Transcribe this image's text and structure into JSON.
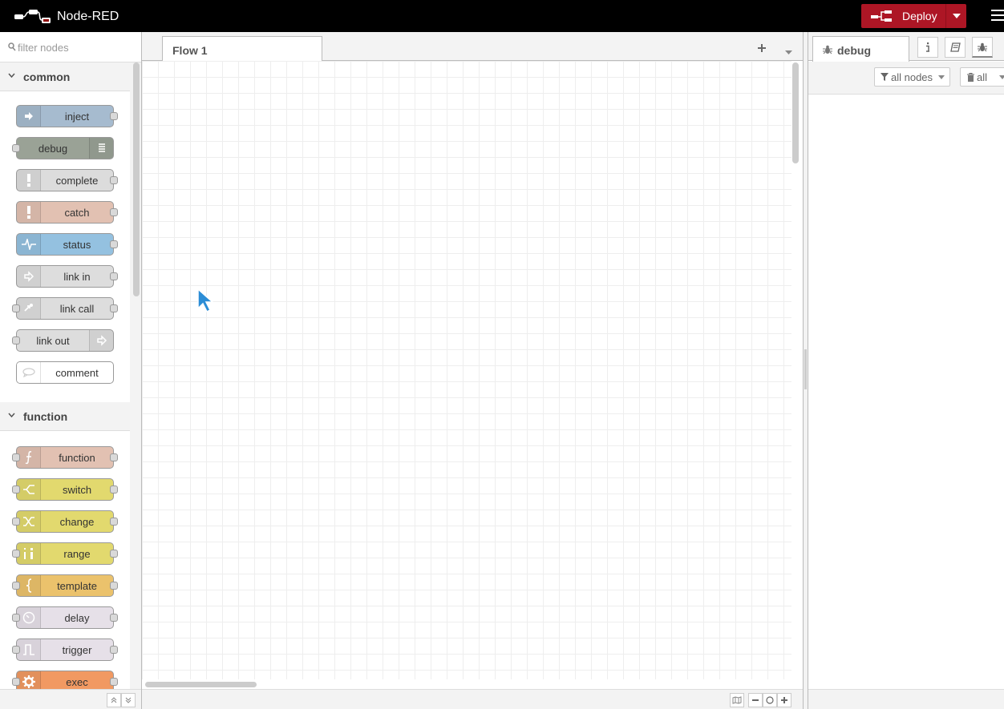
{
  "header": {
    "app_name": "Node-RED",
    "deploy_label": "Deploy"
  },
  "palette": {
    "search_placeholder": "filter nodes",
    "categories": [
      {
        "label": "common",
        "nodes": [
          {
            "label": "inject",
            "color": "#a6bbcf"
          },
          {
            "label": "debug",
            "color": "#87a980"
          },
          {
            "label": "complete",
            "color": "#e0e0e0"
          },
          {
            "label": "catch",
            "color": "#e2c1b2"
          },
          {
            "label": "status",
            "color": "#94c1d0"
          },
          {
            "label": "link in",
            "color": "#dddddd"
          },
          {
            "label": "link call",
            "color": "#dddddd"
          },
          {
            "label": "link out",
            "color": "#dddddd"
          },
          {
            "label": "comment",
            "color": "#ffffff"
          }
        ]
      },
      {
        "label": "function",
        "nodes": [
          {
            "label": "function",
            "color": "#e2c1b2"
          },
          {
            "label": "switch",
            "color": "#e2d96e"
          },
          {
            "label": "change",
            "color": "#e2d96e"
          },
          {
            "label": "range",
            "color": "#e2d96e"
          },
          {
            "label": "template",
            "color": "#ebc26c"
          },
          {
            "label": "delay",
            "color": "#e6e0f8"
          },
          {
            "label": "trigger",
            "color": "#e6e0f8"
          },
          {
            "label": "exec",
            "color": "#f19962"
          }
        ]
      }
    ]
  },
  "workspace": {
    "tabs": [
      {
        "label": "Flow 1"
      }
    ]
  },
  "sidebar": {
    "active_tab": "debug",
    "filter_label": "all nodes",
    "clear_label": "all"
  },
  "colors": {
    "header_bg": "#000000",
    "deploy_bg": "#ad1625"
  },
  "icons": [
    "search-icon",
    "chevron-down-icon",
    "plus-icon",
    "bug-icon",
    "info-icon",
    "book-icon",
    "filter-icon",
    "trash-icon",
    "map-icon",
    "zoom-out-icon",
    "zoom-reset-icon",
    "zoom-in-icon",
    "hamburger-menu-icon"
  ]
}
